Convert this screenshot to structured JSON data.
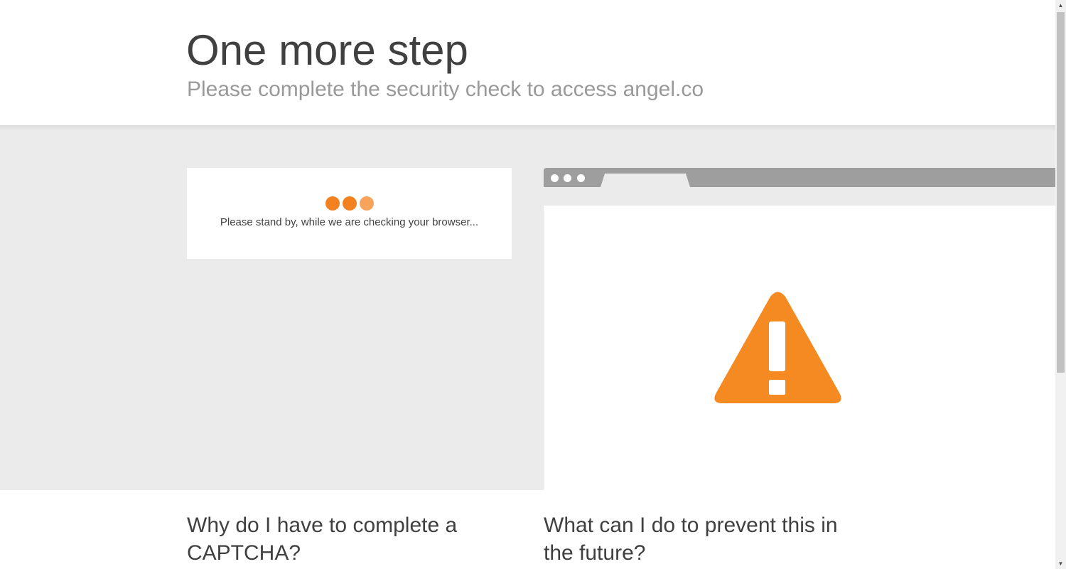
{
  "header": {
    "title": "One more step",
    "subtitle": "Please complete the security check to access angel.co"
  },
  "check": {
    "message": "Please stand by, while we are checking your browser...",
    "dot_colors": [
      "#f48120",
      "#f48120",
      "#f7a35c"
    ]
  },
  "browser_illustration": {
    "bar_color": "#9e9e9e",
    "icon": "warning-icon",
    "icon_color": "#f48a21"
  },
  "sections": {
    "why_heading": "Why do I have to complete a CAPTCHA?",
    "prevent_heading": "What can I do to prevent this in the future?"
  },
  "scrollbar": {
    "up_glyph": "▲",
    "down_glyph": "▼"
  }
}
